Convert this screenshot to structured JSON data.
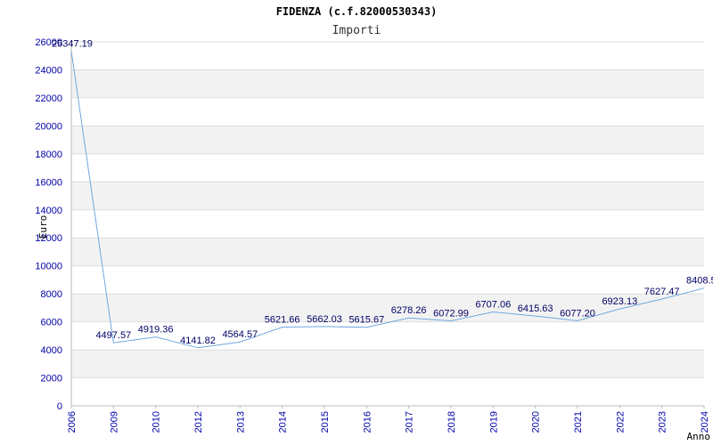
{
  "chart_data": {
    "type": "line",
    "title": "FIDENZA (c.f.82000530343)",
    "subtitle": "Importi",
    "xlabel": "Anno",
    "ylabel": "Euro",
    "categories": [
      "2006",
      "2009",
      "2010",
      "2012",
      "2013",
      "2014",
      "2015",
      "2016",
      "2017",
      "2018",
      "2019",
      "2020",
      "2021",
      "2022",
      "2023",
      "2024"
    ],
    "values": [
      25347.19,
      4497.57,
      4919.36,
      4141.82,
      4564.57,
      5621.66,
      5662.03,
      5615.67,
      6278.26,
      6072.99,
      6707.06,
      6415.63,
      6077.2,
      6923.13,
      7627.47,
      8408.5
    ],
    "data_labels": [
      "25347.19",
      "4497.57",
      "4919.36",
      "4141.82",
      "4564.57",
      "5621.66",
      "5662.03",
      "5615.67",
      "6278.26",
      "6072.99",
      "6707.06",
      "6415.63",
      "6077.20",
      "6923.13",
      "7627.47",
      "8408.5"
    ],
    "yticks": [
      "0",
      "2000",
      "4000",
      "6000",
      "8000",
      "10000",
      "12000",
      "14000",
      "16000",
      "18000",
      "20000",
      "22000",
      "24000",
      "26000"
    ],
    "ylim": [
      0,
      26000
    ],
    "grid": true,
    "line_color": "#6fa8e0",
    "band_color": "#f2f2f2",
    "grid_color": "#dddddd",
    "tick_color": "#0000aa"
  }
}
